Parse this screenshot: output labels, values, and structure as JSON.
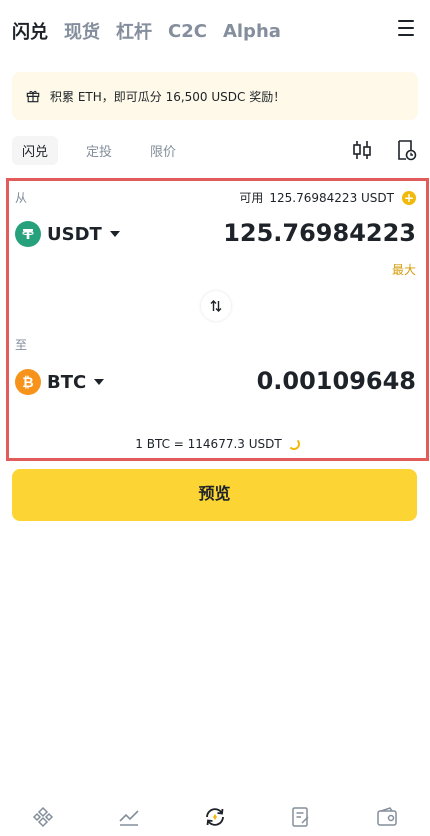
{
  "top_tabs": [
    {
      "label": "闪兑",
      "active": true
    },
    {
      "label": "现货",
      "active": false
    },
    {
      "label": "杠杆",
      "active": false
    },
    {
      "label": "C2C",
      "active": false
    },
    {
      "label": "Alpha",
      "active": false
    }
  ],
  "banner": {
    "text": "积累 ETH，即可瓜分 16,500 USDC 奖励！",
    "icon": "gift-icon"
  },
  "sub_tabs": [
    {
      "label": "闪兑",
      "active": true
    },
    {
      "label": "定投",
      "active": false
    },
    {
      "label": "限价",
      "active": false
    }
  ],
  "from": {
    "label": "从",
    "available_label": "可用",
    "available_value": "125.76984223 USDT",
    "coin": "USDT",
    "amount": "125.76984223",
    "max_label": "最大"
  },
  "to": {
    "label": "至",
    "coin": "BTC",
    "amount": "0.00109648"
  },
  "rate": "1 BTC = 114677.3 USDT",
  "preview_button": "预览",
  "colors": {
    "accent": "#fcd535",
    "brand_gold": "#f0b90b",
    "usdt_green": "#26a17b",
    "btc_orange": "#f7931a",
    "highlight_border": "#e25c5c"
  },
  "bottom_nav": [
    "home-icon",
    "markets-icon",
    "trade-icon",
    "futures-icon",
    "wallet-icon"
  ]
}
